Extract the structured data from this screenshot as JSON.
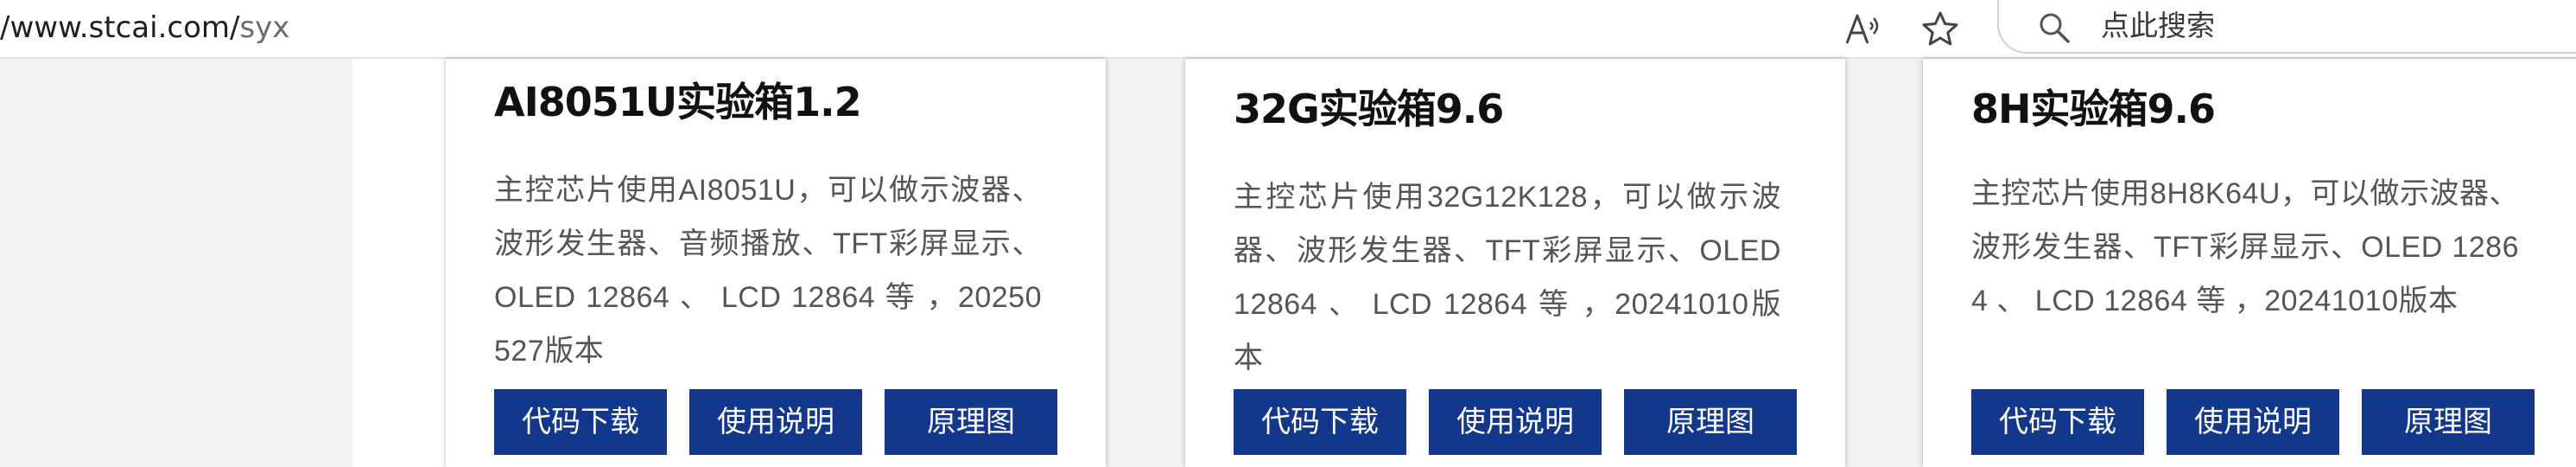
{
  "browser": {
    "url_host": "/www.stcai.com/",
    "url_path": "syx",
    "read_aloud_icon": "read-aloud-icon",
    "favorite_icon": "star-icon",
    "search_icon": "magnifier-icon",
    "search_placeholder": "点此搜索"
  },
  "colors": {
    "button_bg": "#13378a",
    "button_text": "#ffffff",
    "title_text": "#111111",
    "desc_text": "#555555",
    "page_bg": "#f2f2f2"
  },
  "cards": [
    {
      "title": "AI8051U实验箱1.2",
      "description": "主控芯片使用AI8051U，可以做示波器、波形发生器、音频播放、TFT彩屏显示、OLED 12864 、 LCD 12864 等 ，20250527版本",
      "buttons": [
        "代码下载",
        "使用说明",
        "原理图"
      ]
    },
    {
      "title": "32G实验箱9.6",
      "description": "主控芯片使用32G12K128，可以做示波器、波形发生器、TFT彩屏显示、OLED 12864 、 LCD 12864 等 ，20241010版本",
      "buttons": [
        "代码下载",
        "使用说明",
        "原理图"
      ]
    },
    {
      "title": "8H实验箱9.6",
      "description": "主控芯片使用8H8K64U，可以做示波器、波形发生器、TFT彩屏显示、OLED 12864 、 LCD 12864 等 ，20241010版本",
      "buttons": [
        "代码下载",
        "使用说明",
        "原理图"
      ]
    }
  ]
}
